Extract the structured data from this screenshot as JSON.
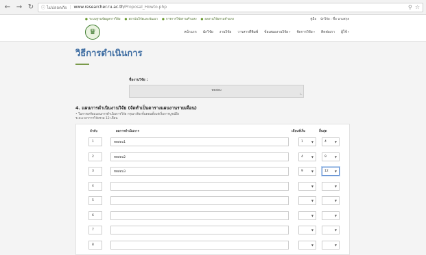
{
  "browser": {
    "secure_label": "ไม่ปลอดภัย",
    "url_host": "www.researcher.ru.ac.th",
    "url_path": "/Proposal_Howto.php"
  },
  "topbar": {
    "links": [
      "ระบบฐานข้อมูลการวิจัย",
      "สถาบันวิจัยและพัฒนา",
      "การการวิจัยรามคำแหง",
      "ผลงานวิจัยรามคำแหง"
    ],
    "user_items": [
      "คู่มือ",
      "นักวิจัย : ชื่อ นามสกุล"
    ]
  },
  "menu": [
    {
      "label": "หน้าแรก",
      "caret": false
    },
    {
      "label": "นักวิจัย",
      "caret": false
    },
    {
      "label": "งานวิจัย",
      "caret": false
    },
    {
      "label": "วารสารตีพิมพ์",
      "caret": false
    },
    {
      "label": "ข้อเสนองานวิจัย",
      "caret": true
    },
    {
      "label": "จัดการวิจัย",
      "caret": true
    },
    {
      "label": "ติดต่อเรา",
      "caret": false
    },
    {
      "label": "ผู้ใช้",
      "caret": true
    }
  ],
  "page_title": "วิธีการดำเนินการ",
  "project": {
    "label": "ชื่องานวิจัย :",
    "value": "ทดสอบ"
  },
  "section": {
    "title": "4. แผนการดำเนินงานวิจัย (จัดทำเป็นตารางแผนงานรายเดือน)",
    "note_line1": "• ในการเตรียมแผนการดำเนินการวิจัย กรุณาเรียงขั้นตอนตั้งแต่เริ่มการบูรณ์ยิง",
    "note_line2": "ระยะเวลาการวิจัยรวม 12 เดือน"
  },
  "table": {
    "headers": [
      "ลำดับ",
      "ผลการดำเนินการ",
      "เดือนที่เริ่ม",
      "สิ้นสุด"
    ],
    "rows": [
      {
        "index": "1",
        "task": "ทดสอบ1",
        "start": "1",
        "end": "4",
        "focus": false
      },
      {
        "index": "2",
        "task": "ทดสอบ2",
        "start": "4",
        "end": "9",
        "focus": false
      },
      {
        "index": "3",
        "task": "ทดสอบ3",
        "start": "9",
        "end": "12",
        "focus": true
      },
      {
        "index": "4",
        "task": "",
        "start": "",
        "end": "",
        "focus": false
      },
      {
        "index": "5",
        "task": "",
        "start": "",
        "end": "",
        "focus": false
      },
      {
        "index": "6",
        "task": "",
        "start": "",
        "end": "",
        "focus": false
      },
      {
        "index": "7",
        "task": "",
        "start": "",
        "end": "",
        "focus": false
      },
      {
        "index": "8",
        "task": "",
        "start": "",
        "end": "",
        "focus": false
      }
    ]
  }
}
